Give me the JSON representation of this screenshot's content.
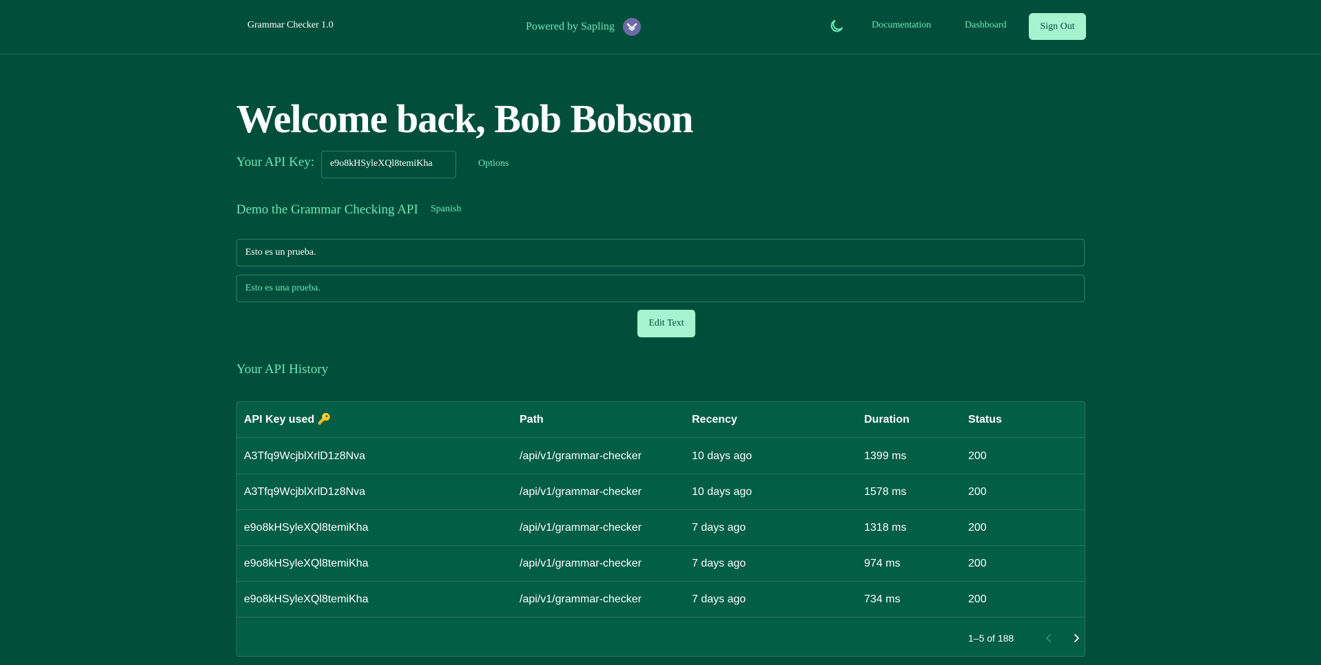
{
  "header": {
    "brand": "Grammar Checker 1.0",
    "powered_by": "Powered by Sapling",
    "nav": {
      "documentation": "Documentation",
      "dashboard": "Dashboard",
      "sign_out": "Sign Out"
    },
    "theme_icon": "moon-icon"
  },
  "welcome": {
    "title": "Welcome back, Bob Bobson"
  },
  "api_key": {
    "label": "Your API Key:",
    "value": "e9o8kHSyleXQl8temiKha",
    "options_label": "Options"
  },
  "demo": {
    "title": "Demo the Grammar Checking API",
    "language": "Spanish",
    "input_value": "Esto es un prueba.",
    "corrected_value": "Esto es una prueba.",
    "edit_button": "Edit Text"
  },
  "history": {
    "title": "Your API History",
    "columns": {
      "key": "API Key used 🔑",
      "path": "Path",
      "recency": "Recency",
      "duration": "Duration",
      "status": "Status"
    },
    "rows": [
      {
        "key": "A3Tfq9WcjblXrlD1z8Nva",
        "path": "/api/v1/grammar-checker",
        "recency": "10 days ago",
        "duration": "1399 ms",
        "status": "200"
      },
      {
        "key": "A3Tfq9WcjblXrlD1z8Nva",
        "path": "/api/v1/grammar-checker",
        "recency": "10 days ago",
        "duration": "1578 ms",
        "status": "200"
      },
      {
        "key": "e9o8kHSyleXQl8temiKha",
        "path": "/api/v1/grammar-checker",
        "recency": "7 days ago",
        "duration": "1318 ms",
        "status": "200"
      },
      {
        "key": "e9o8kHSyleXQl8temiKha",
        "path": "/api/v1/grammar-checker",
        "recency": "7 days ago",
        "duration": "974 ms",
        "status": "200"
      },
      {
        "key": "e9o8kHSyleXQl8temiKha",
        "path": "/api/v1/grammar-checker",
        "recency": "7 days ago",
        "duration": "734 ms",
        "status": "200"
      }
    ],
    "pagination": "1–5 of 188"
  },
  "colors": {
    "background": "#014f3a",
    "accent": "#6ee7b7",
    "button": "#a7f3d0",
    "table": "#025e45"
  }
}
